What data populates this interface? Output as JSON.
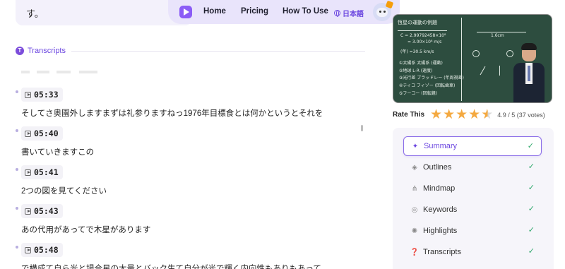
{
  "top_text": "す。",
  "nav": {
    "links": [
      "Home",
      "Pricing",
      "How To Use"
    ],
    "language": "日本語",
    "accent": "#8b5cf6"
  },
  "transcripts": {
    "heading": "Transcripts",
    "entries": [
      {
        "time": "05:33",
        "text": "そしてさ奥園外しますまずは礼参りますねっ1976年目標食とは何かというとそれを"
      },
      {
        "time": "05:40",
        "text": "書いていきますこの"
      },
      {
        "time": "05:41",
        "text": "2つの図を見てください"
      },
      {
        "time": "05:43",
        "text": "あの代用があってで木星があります"
      },
      {
        "time": "05:48",
        "text": "で構成て自ら光と場合星の大量とバック生て自分が光で輝く内向性もありもあって"
      }
    ]
  },
  "video": {
    "chalk_lines": [
      "恆星の運動の例題",
      "C = 2.99792458×10⁸",
      "= 3.00×10⁸ m/s",
      "(年) =30.5 km/s",
      "①太陽系 太陽系 (運動)",
      "②地球 L-R (速度)",
      "③光行差 ブラッドレー (年周視差)",
      "④ティコ フィゾー (回転歯車)",
      "⑤フーコー (回転鏡)",
      "1.6cm"
    ]
  },
  "rating": {
    "label": "Rate This",
    "stars": 4.5,
    "score_text": "4.9 / 5 (37 votes)",
    "star_color": "#f4a940"
  },
  "menu": {
    "items": [
      {
        "label": "Summary",
        "icon": "sparkle-icon",
        "active": true
      },
      {
        "label": "Outlines",
        "icon": "cube-icon",
        "active": false
      },
      {
        "label": "Mindmap",
        "icon": "mindmap-icon",
        "active": false
      },
      {
        "label": "Keywords",
        "icon": "target-icon",
        "active": false
      },
      {
        "label": "Highlights",
        "icon": "bulb-icon",
        "active": false
      },
      {
        "label": "Transcripts",
        "icon": "question-icon",
        "active": false
      }
    ],
    "check_color": "#2ea86b"
  }
}
